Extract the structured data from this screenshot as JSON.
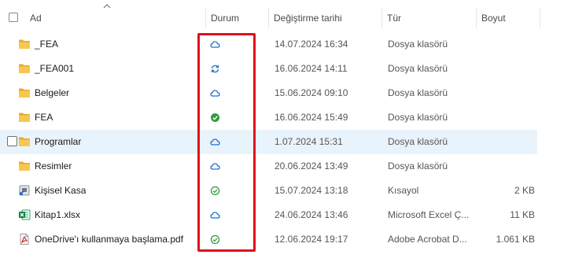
{
  "columns": {
    "name": "Ad",
    "status": "Durum",
    "modified": "Değiştirme tarihi",
    "type": "Tür",
    "size": "Boyut"
  },
  "rows": [
    {
      "name": "_FEA",
      "icon": "folder-icon",
      "status": "cloud-icon",
      "modified": "14.07.2024 16:34",
      "type": "Dosya klasörü",
      "size": ""
    },
    {
      "name": "_FEA001",
      "icon": "folder-icon",
      "status": "sync-icon",
      "modified": "16.06.2024 14:11",
      "type": "Dosya klasörü",
      "size": ""
    },
    {
      "name": "Belgeler",
      "icon": "folder-icon",
      "status": "cloud-icon",
      "modified": "15.06.2024 09:10",
      "type": "Dosya klasörü",
      "size": ""
    },
    {
      "name": "FEA",
      "icon": "folder-icon",
      "status": "check-filled-icon",
      "modified": "16.06.2024 15:49",
      "type": "Dosya klasörü",
      "size": ""
    },
    {
      "name": "Programlar",
      "icon": "folder-icon",
      "status": "cloud-icon",
      "modified": "1.07.2024 15:31",
      "type": "Dosya klasörü",
      "size": "",
      "selected": true
    },
    {
      "name": "Resimler",
      "icon": "folder-icon",
      "status": "cloud-icon",
      "modified": "20.06.2024 13:49",
      "type": "Dosya klasörü",
      "size": ""
    },
    {
      "name": "Kişisel Kasa",
      "icon": "shortcut-icon",
      "status": "check-outline-icon",
      "modified": "15.07.2024 13:18",
      "type": "Kısayol",
      "size": "2 KB"
    },
    {
      "name": "Kitap1.xlsx",
      "icon": "excel-icon",
      "status": "cloud-icon",
      "modified": "24.06.2024 13:46",
      "type": "Microsoft Excel Ç...",
      "size": "11 KB"
    },
    {
      "name": "OneDrive'ı kullanmaya başlama.pdf",
      "icon": "pdf-icon",
      "status": "check-outline-icon",
      "modified": "12.06.2024 19:17",
      "type": "Adobe Acrobat D...",
      "size": "1.061 KB"
    }
  ],
  "colors": {
    "accent": "#1a73c7",
    "sync_green": "#2e9d3e",
    "folder": "#f5c34a",
    "highlight": "#e0101e",
    "selected_row": "#e9f3fc"
  }
}
